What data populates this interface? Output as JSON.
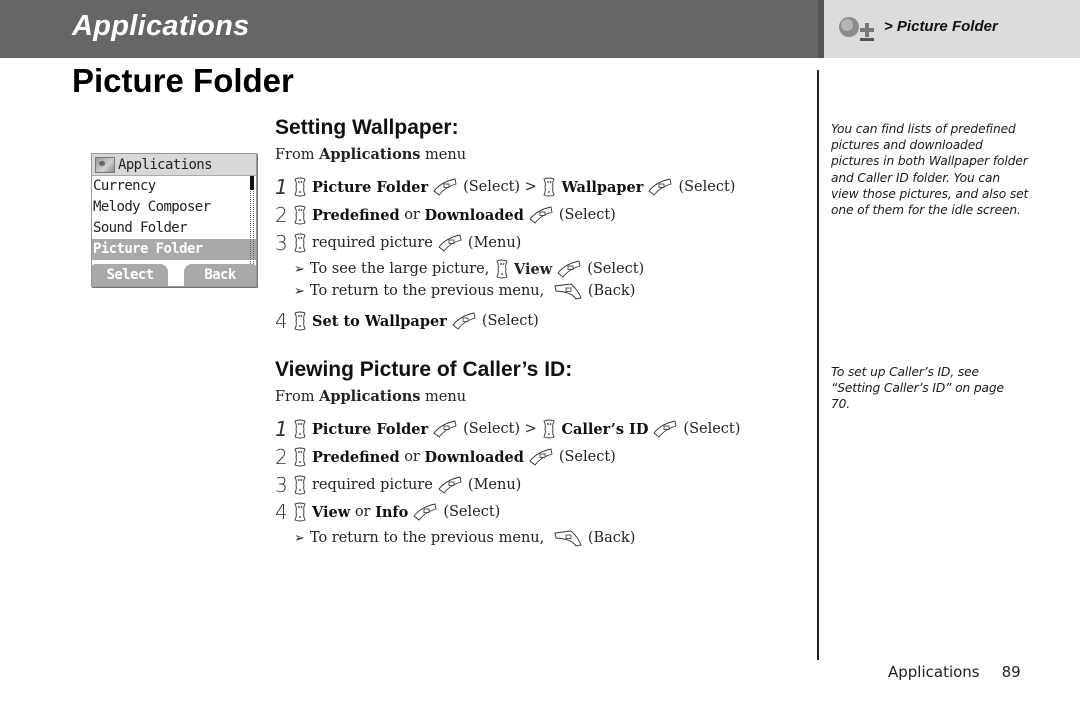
{
  "header": {
    "section_title": "Applications",
    "breadcrumb": "> Picture Folder",
    "breadcrumb_icon": "apps-icon"
  },
  "page_title": "Picture Folder",
  "phone_screen": {
    "title": "Applications",
    "items": [
      "Currency",
      "Melody Composer",
      "Sound  Folder",
      "Picture Folder"
    ],
    "selected_index": 3,
    "soft_left": "Select",
    "soft_right": "Back"
  },
  "sections": [
    {
      "title": "Setting Wallpaper:",
      "from_prefix": "From ",
      "from_menu": "Applications",
      "from_suffix": " menu",
      "steps": [
        {
          "num": "1",
          "parts": [
            {
              "icon": "nav"
            },
            {
              "b": "Picture Folder"
            },
            {
              "icon": "soft"
            },
            {
              "t": "(Select) > "
            },
            {
              "icon": "nav"
            },
            {
              "b": "Wallpaper"
            },
            {
              "icon": "soft"
            },
            {
              "t": "(Select)"
            }
          ]
        },
        {
          "num": "2",
          "parts": [
            {
              "icon": "nav"
            },
            {
              "b": "Predefined"
            },
            {
              "t": " or "
            },
            {
              "b": "Downloaded"
            },
            {
              "icon": "soft"
            },
            {
              "t": "(Select)"
            }
          ]
        },
        {
          "num": "3",
          "parts": [
            {
              "icon": "nav"
            },
            {
              "t": "required picture"
            },
            {
              "icon": "soft"
            },
            {
              "t": "(Menu)"
            }
          ]
        }
      ],
      "notes": [
        {
          "parts": [
            {
              "t": "To see the large picture, "
            },
            {
              "icon": "nav"
            },
            {
              "b": "View"
            },
            {
              "icon": "soft"
            },
            {
              "t": "(Select)"
            }
          ]
        },
        {
          "parts": [
            {
              "t": "To return to the previous menu, "
            },
            {
              "icon": "back"
            },
            {
              "t": "(Back)"
            }
          ]
        }
      ],
      "final_step": {
        "num": "4",
        "parts": [
          {
            "icon": "nav"
          },
          {
            "b": "Set to Wallpaper"
          },
          {
            "icon": "soft"
          },
          {
            "t": "(Select)"
          }
        ]
      }
    },
    {
      "title": "Viewing Picture of Caller’s ID:",
      "from_prefix": "From ",
      "from_menu": "Applications",
      "from_suffix": " menu",
      "steps": [
        {
          "num": "1",
          "parts": [
            {
              "icon": "nav"
            },
            {
              "b": "Picture Folder"
            },
            {
              "icon": "soft"
            },
            {
              "t": "(Select) > "
            },
            {
              "icon": "nav"
            },
            {
              "b": "Caller’s ID"
            },
            {
              "icon": "soft"
            },
            {
              "t": "(Select)"
            }
          ]
        },
        {
          "num": "2",
          "parts": [
            {
              "icon": "nav"
            },
            {
              "b": "Predefined"
            },
            {
              "t": " or "
            },
            {
              "b": "Downloaded"
            },
            {
              "icon": "soft"
            },
            {
              "t": "(Select)"
            }
          ]
        },
        {
          "num": "3",
          "parts": [
            {
              "icon": "nav"
            },
            {
              "t": "required picture"
            },
            {
              "icon": "soft"
            },
            {
              "t": "(Menu)"
            }
          ]
        },
        {
          "num": "4",
          "parts": [
            {
              "icon": "nav"
            },
            {
              "b": "View"
            },
            {
              "t": " or "
            },
            {
              "b": "Info"
            },
            {
              "icon": "soft"
            },
            {
              "t": "(Select)"
            }
          ]
        }
      ],
      "notes": [
        {
          "parts": [
            {
              "t": "To return to the previous menu, "
            },
            {
              "icon": "back"
            },
            {
              "t": "(Back)"
            }
          ]
        }
      ]
    }
  ],
  "side_notes": [
    "You can find lists of predefined pictures and downloaded pictures in both Wallpaper folder and Caller ID folder. You can view those pictures, and also set one of them for the idle screen.",
    "To set up Caller’s ID, see “Setting Caller’s ID” on page 70."
  ],
  "footer": {
    "section": "Applications",
    "page_number": "89"
  },
  "colors": {
    "header_band": "#666666",
    "side_header": "#dcdcdc",
    "phone_highlight": "#a9a9a9"
  }
}
